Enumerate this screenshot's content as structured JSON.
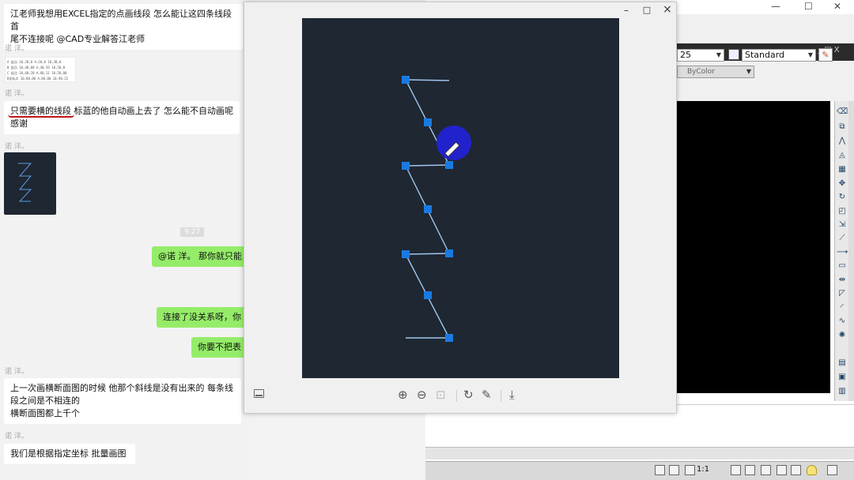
{
  "chat": {
    "messages": [
      {
        "text_line1": "江老师我想用EXCEL指定的点画线段  怎么能让这四条线段首",
        "text_line2": "尾不连接呢  @CAD专业解答江老师"
      },
      {
        "sender": "诺 洋。"
      },
      {
        "sender": "诺 洋。"
      },
      {
        "sender": "诺 洋。"
      }
    ],
    "sender1": "诺 洋。",
    "sender2": "诺 洋。",
    "sender3": "诺 洋。",
    "sender4": "诺 洋。",
    "sender5": "诺 洋。",
    "msg1_line1": "江老师我想用EXCEL指定的点画线段  怎么能让这四条线段首",
    "msg1_line2": "尾不连接呢  @CAD专业解答江老师",
    "table_rows": [
      "A 起点  10,20,0   A,20,0   10,30,0",
      "B 起点  10,40,00  A,40,56  10,50,0",
      "C 起点  10,60,20  A,60,11  10,50,00",
      "D坐标点 10,80,00  A,80,00  10,90,22"
    ],
    "msg2_highlight": "只需要横的线段",
    "msg2_rest": "  标蓝的他自动画上去了  怎么能不自动画呢",
    "msg2_line2": "感谢",
    "time": "9:27",
    "out1": "@诺 洋。  那你就只能",
    "out2": "连接了没关系呀，你",
    "out3": "你要不把表",
    "msg3_line1": "上一次画横断面图的时候  他那个斜线是没有出来的   每条线",
    "msg3_line2": "段之间是不相连的",
    "msg3_line3": "横断面图都上千个",
    "msg4": "我们是根据指定坐标  批量画图"
  },
  "viewer": {
    "controls": {
      "minimize": "–",
      "maximize": "□",
      "close": "×"
    },
    "toolbar": {
      "zoom_in": "⊕",
      "zoom_out": "⊖",
      "actual_size": "⊡",
      "rotate": "↻",
      "edit": "✎",
      "download": "⤓"
    }
  },
  "cad": {
    "title_controls": {
      "minimize": "—",
      "maximize": "☐",
      "close": "✕"
    },
    "sub_controls": "_ □ X",
    "scale_combo": "25",
    "style_combo": "Standard",
    "color_combo": "ByColor",
    "status_scale": "1:1"
  },
  "colors": {
    "canvas_bg": "#1f2732",
    "grip": "#1a7ae0",
    "line": "#9fc6f0",
    "cursor_disc": "#2222cc",
    "chat_out": "#95ec69"
  }
}
